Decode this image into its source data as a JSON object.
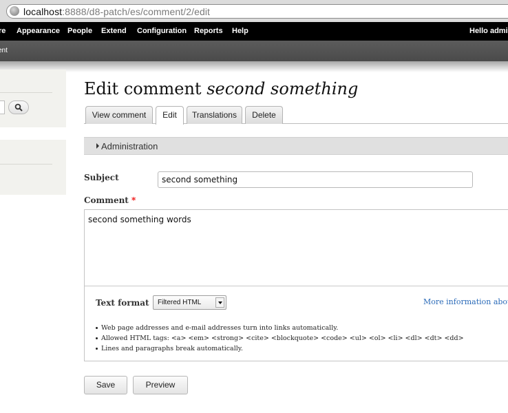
{
  "browser": {
    "url_host": "localhost",
    "url_path": ":8888/d8-patch/es/comment/2/edit"
  },
  "toolbar": {
    "items": [
      {
        "label": "re"
      },
      {
        "label": "Appearance"
      },
      {
        "label": "People"
      },
      {
        "label": "Extend"
      },
      {
        "label": "Configuration"
      },
      {
        "label": "Reports"
      },
      {
        "label": "Help"
      }
    ],
    "hello": "Hello admi"
  },
  "shortcuts": {
    "label": "ent"
  },
  "page": {
    "title_prefix": "Edit comment",
    "title_emphasis": "second something"
  },
  "tabs": [
    {
      "label": "View comment",
      "active": false
    },
    {
      "label": "Edit",
      "active": true
    },
    {
      "label": "Translations",
      "active": false
    },
    {
      "label": "Delete",
      "active": false
    }
  ],
  "administration": {
    "label": "Administration"
  },
  "form": {
    "subject_label": "Subject",
    "subject_value": "second something",
    "comment_label": "Comment",
    "required_marker": "*",
    "comment_value": "second something words",
    "text_format_label": "Text format",
    "text_format_value": "Filtered HTML",
    "more_info_link": "More information about t",
    "tips": [
      "Web page addresses and e-mail addresses turn into links automatically.",
      "Allowed HTML tags: <a> <em> <strong> <cite> <blockquote> <code> <ul> <ol> <li> <dl> <dt> <dd>",
      "Lines and paragraphs break automatically."
    ]
  },
  "actions": {
    "save_label": "Save",
    "preview_label": "Preview"
  },
  "colors": {
    "toolbar_bg": "#000000",
    "link": "#2a6ab8",
    "required": "#ee0000"
  },
  "icons": [
    "globe-icon",
    "search-icon",
    "collapse-triangle-icon",
    "dropdown-arrow-icon"
  ]
}
